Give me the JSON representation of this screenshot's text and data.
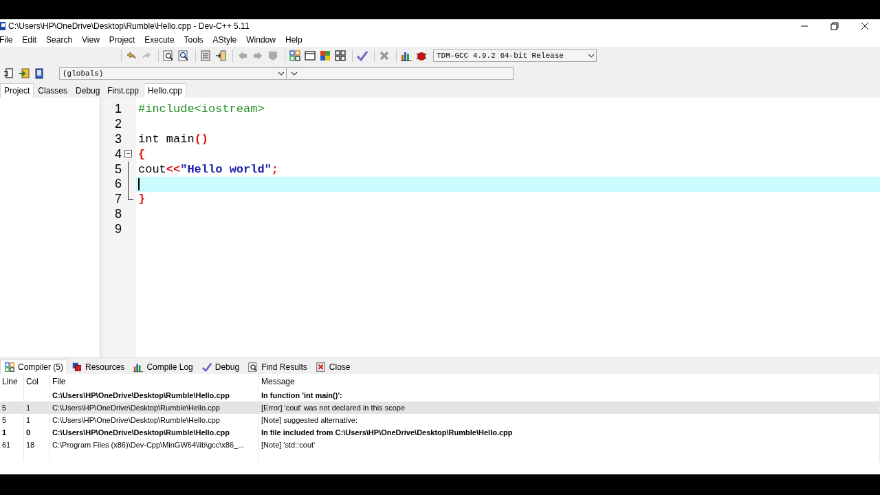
{
  "window": {
    "title": "C:\\Users\\HP\\OneDrive\\Desktop\\Rumble\\Hello.cpp - Dev-C++ 5.11"
  },
  "menu": [
    "File",
    "Edit",
    "Search",
    "View",
    "Project",
    "Execute",
    "Tools",
    "AStyle",
    "Window",
    "Help"
  ],
  "compiler_select": {
    "value": "TDM-GCC 4.9.2 64-bit Release"
  },
  "scope_select": {
    "value": "(globals)"
  },
  "side_tabs": [
    {
      "label": "Project",
      "selected": true
    },
    {
      "label": "Classes",
      "selected": false
    },
    {
      "label": "Debug",
      "selected": false
    }
  ],
  "file_tabs": [
    {
      "label": "First.cpp",
      "selected": false
    },
    {
      "label": "Hello.cpp",
      "selected": true
    }
  ],
  "editor": {
    "lines": [
      {
        "number": "1",
        "current": false,
        "tokens": [
          {
            "text": "#include<iostream>",
            "kind": "preprocessor"
          }
        ]
      },
      {
        "number": "2",
        "current": false
      },
      {
        "number": "3",
        "current": false,
        "tokens": [
          {
            "text": "int main",
            "kind": "plain"
          },
          {
            "text": "()",
            "kind": "symbol"
          }
        ]
      },
      {
        "number": "4",
        "current": false,
        "fold_start": true,
        "tokens": [
          {
            "text": "{",
            "kind": "symbol"
          }
        ]
      },
      {
        "number": "5",
        "current": false,
        "tokens": [
          {
            "text": "cout",
            "kind": "plain"
          },
          {
            "text": "<<",
            "kind": "symbol"
          },
          {
            "text": "\"Hello world\"",
            "kind": "string"
          },
          {
            "text": ";",
            "kind": "symbol"
          }
        ]
      },
      {
        "number": "6",
        "current": true
      },
      {
        "number": "7",
        "current": false,
        "fold_end": true,
        "tokens": [
          {
            "text": "}",
            "kind": "symbol"
          }
        ]
      },
      {
        "number": "8",
        "current": false
      },
      {
        "number": "9",
        "current": false
      }
    ]
  },
  "bottom_tabs": [
    {
      "label": "Compiler (5)",
      "selected": true
    },
    {
      "label": "Resources",
      "selected": false
    },
    {
      "label": "Compile Log",
      "selected": false
    },
    {
      "label": "Debug",
      "selected": false
    },
    {
      "label": "Find Results",
      "selected": false
    },
    {
      "label": "Close",
      "selected": false
    }
  ],
  "messages": {
    "columns": [
      "Line",
      "Col",
      "File",
      "Message"
    ],
    "rows": [
      {
        "file": "C:\\Users\\HP\\OneDrive\\Desktop\\Rumble\\Hello.cpp",
        "message": "In function 'int main()':",
        "bold": true,
        "selected": false
      },
      {
        "line": "5",
        "col": "1",
        "file": "C:\\Users\\HP\\OneDrive\\Desktop\\Rumble\\Hello.cpp",
        "message": "[Error] 'cout' was not declared in this scope",
        "bold": false,
        "selected": true
      },
      {
        "line": "5",
        "col": "1",
        "file": "C:\\Users\\HP\\OneDrive\\Desktop\\Rumble\\Hello.cpp",
        "message": "[Note] suggested alternative:",
        "bold": false,
        "selected": false
      },
      {
        "line": "1",
        "col": "0",
        "file": "C:\\Users\\HP\\OneDrive\\Desktop\\Rumble\\Hello.cpp",
        "message": "In file included from C:\\Users\\HP\\OneDrive\\Desktop\\Rumble\\Hello.cpp",
        "bold": true,
        "selected": false
      },
      {
        "line": "61",
        "col": "18",
        "file": "C:\\Program Files (x86)\\Dev-Cpp\\MinGW64\\lib\\gcc\\x86_...",
        "message": "[Note] 'std::cout'",
        "bold": false,
        "selected": false
      }
    ]
  }
}
